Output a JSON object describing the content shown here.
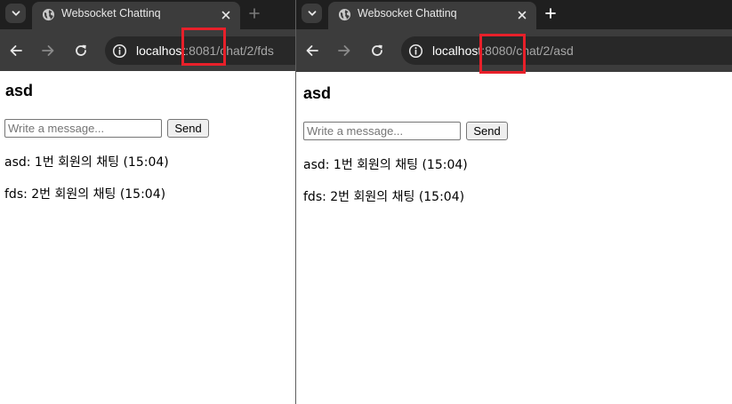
{
  "left_window": {
    "tab": {
      "title": "Websocket Chattinq"
    },
    "omnibox": {
      "host": "localhost",
      "path": ":8081/chat/2/fds"
    },
    "page": {
      "title": "asd",
      "input_placeholder": "Write a message...",
      "send_label": "Send",
      "messages": [
        {
          "text": "asd: 1번 회원의 채팅 (15:04)"
        },
        {
          "text": "fds: 2번 회원의 채팅 (15:04)"
        }
      ]
    }
  },
  "right_window": {
    "tab": {
      "title": "Websocket Chattinq"
    },
    "omnibox": {
      "host": "localhost",
      "path": ":8080/chat/2/asd"
    },
    "page": {
      "title": "asd",
      "input_placeholder": "Write a message...",
      "send_label": "Send",
      "messages": [
        {
          "text": "asd: 1번 회원의 채팅 (15:04)"
        },
        {
          "text": "fds: 2번 회원의 채팅 (15:04)"
        }
      ]
    }
  },
  "icons": {
    "tab_search": "chevron-down-icon",
    "favicon": "globe-icon",
    "close": "close-icon",
    "new_tab": "plus-icon",
    "back": "arrow-left-icon",
    "forward": "arrow-right-icon",
    "reload": "reload-icon",
    "site_info": "info-icon"
  },
  "colors": {
    "tab_strip": "#1f1f1f",
    "toolbar": "#3c3c3c",
    "omnibox": "#282828",
    "annotation": "#e8202a"
  }
}
